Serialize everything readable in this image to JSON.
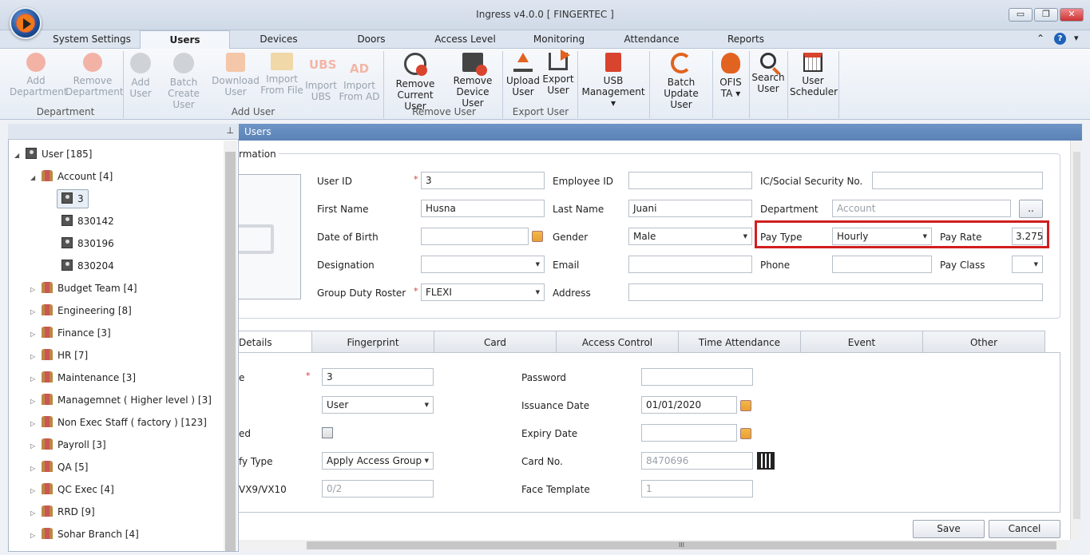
{
  "window": {
    "title": "Ingress v4.0.0 [ FINGERTEC ]",
    "min_icon": "minimize-icon",
    "restore_icon": "restore-icon",
    "close_icon": "close-icon",
    "min": "▭",
    "restore": "❐",
    "close": "✕"
  },
  "ribbon_tabs": [
    "System Settings",
    "Users",
    "Devices",
    "Doors",
    "Access Level",
    "Monitoring",
    "Attendance",
    "Reports"
  ],
  "ribbon_right": {
    "collapse": "⌃",
    "help": "?",
    "more": "▾"
  },
  "ribbon": {
    "add_department": "Add\nDepartment",
    "remove_department": "Remove\nDepartment",
    "group_department": "Department",
    "add_user": "Add\nUser",
    "batch_create": "Batch\nCreate User",
    "download_user": "Download\nUser",
    "import_file": "Import\nFrom File",
    "import_ubs": "Import\nUBS",
    "import_ad": "Import\nFrom AD",
    "group_add_user": "Add User",
    "ubs_text": "UBS",
    "ad_text": "AD",
    "remove_current": "Remove\nCurrent User",
    "remove_device": "Remove\nDevice User",
    "group_remove": "Remove User",
    "upload_user": "Upload\nUser",
    "export_user": "Export\nUser",
    "group_export": "Export User",
    "usb": "USB\nManagement ▾",
    "batch_update": "Batch\nUpdate User",
    "ofis": "OFIS\nTA ▾",
    "search_user": "Search\nUser",
    "user_scheduler": "User\nScheduler"
  },
  "tree": {
    "root": "User [185]",
    "account": "Account [4]",
    "users": [
      "3",
      "830142",
      "830196",
      "830204"
    ],
    "groups": [
      "Budget Team [4]",
      "Engineering [8]",
      "Finance [3]",
      "HR [7]",
      "Maintenance [3]",
      "Managemnet ( Higher level ) [3]",
      "Non Exec Staff ( factory ) [123]",
      "Payroll [3]",
      "QA  [5]",
      "QC Exec [4]",
      "RRD [9]",
      "Sohar Branch [4]"
    ]
  },
  "panel_title": "Users",
  "section_title": "rmation",
  "form": {
    "user_id_label": "User ID",
    "user_id": "3",
    "employee_id_label": "Employee ID",
    "employee_id": "",
    "ic_label": "IC/Social Security No.",
    "ic": "",
    "first_name_label": "First Name",
    "first_name": "Husna",
    "last_name_label": "Last Name",
    "last_name": "Juani",
    "department_label": "Department",
    "department_placeholder": "Account",
    "dept_btn": "..",
    "dob_label": "Date of Birth",
    "dob": "",
    "gender_label": "Gender",
    "gender": "Male",
    "pay_type_label": "Pay Type",
    "pay_type": "Hourly",
    "pay_rate_label": "Pay Rate",
    "pay_rate": "3.275",
    "designation_label": "Designation",
    "designation": "",
    "email_label": "Email",
    "email": "",
    "phone_label": "Phone",
    "phone": "",
    "pay_class_label": "Pay Class",
    "pay_class": "",
    "gdr_label": "Group Duty Roster",
    "gdr": "FLEXI",
    "address_label": "Address",
    "address": ""
  },
  "detail_tabs": [
    "Details",
    "Fingerprint",
    "Card",
    "Access Control",
    "Time Attendance",
    "Event",
    "Other"
  ],
  "details": {
    "r1_label": "e",
    "r1_value": "3",
    "r2_value": "User",
    "r3_label": "ed",
    "r4_label": "fy Type",
    "r4_value": "Apply Access Group",
    "r5_label": "VX9/VX10",
    "r5_value": "0/2",
    "password_label": "Password",
    "password": "",
    "issuance_label": "Issuance Date",
    "issuance": "01/01/2020",
    "expiry_label": "Expiry Date",
    "expiry": "",
    "card_label": "Card No.",
    "card": "8470696",
    "face_label": "Face Template",
    "face": "1"
  },
  "buttons": {
    "save": "Save",
    "cancel": "Cancel"
  },
  "scroll": {
    "grip": "III"
  }
}
